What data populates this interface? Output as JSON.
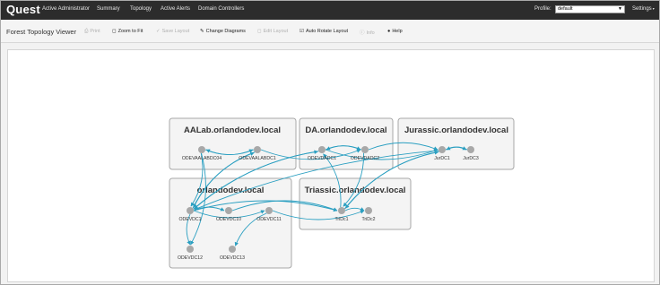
{
  "app": {
    "logo": "Quest",
    "nav": [
      "Active Administrator",
      "Summary",
      "Topology",
      "Active Alerts",
      "Domain Controllers"
    ],
    "profile_label": "Profile:",
    "profile_value": "default",
    "settings_label": "Settings"
  },
  "toolbar": {
    "title": "Forest Topology Viewer",
    "items": [
      {
        "label": "Print",
        "icon": "print-icon",
        "enabled": false
      },
      {
        "label": "Zoom to Fit",
        "icon": "zoom-fit-icon",
        "enabled": true
      },
      {
        "label": "Save Layout",
        "icon": "save-icon",
        "enabled": false
      },
      {
        "label": "Change Diagrams",
        "icon": "pencil-icon",
        "enabled": true
      },
      {
        "label": "Edit Layout",
        "icon": "edit-icon",
        "enabled": false
      },
      {
        "label": "Auto Rotate Layout",
        "icon": "checkbox-checked-icon",
        "enabled": true
      },
      {
        "label": "Info",
        "icon": "info-icon",
        "enabled": false
      },
      {
        "label": "Help",
        "icon": "help-icon",
        "enabled": true
      }
    ]
  },
  "colors": {
    "topbar": "#2c2c2c",
    "edge": "#2a9fc1",
    "node": "#a8a8a8",
    "domain_fill": "#f4f4f4"
  },
  "topology": {
    "domains": [
      {
        "name": "AALab.orlandodev.local"
      },
      {
        "name": "DA.orlandodev.local"
      },
      {
        "name": "Jurassic.orlandodev.local"
      },
      {
        "name": "orlandodev.local"
      },
      {
        "name": "Triassic.orlandodev.local"
      }
    ],
    "nodes": [
      {
        "id": "ODEVAALABDC04"
      },
      {
        "id": "ODEVAALABDC1"
      },
      {
        "id": "ODEVDADC1"
      },
      {
        "id": "ODEVDADC2"
      },
      {
        "id": "JurDC1"
      },
      {
        "id": "JurDC3"
      },
      {
        "id": "ODEVDC1"
      },
      {
        "id": "ODEVDC10"
      },
      {
        "id": "ODEVDC11"
      },
      {
        "id": "ODEVDC12"
      },
      {
        "id": "ODEVDC13"
      },
      {
        "id": "TriDc1"
      },
      {
        "id": "TriDc2"
      }
    ],
    "links": [
      [
        "ODEVAALABDC04",
        "ODEVAALABDC1"
      ],
      [
        "ODEVAALABDC1",
        "ODEVAALABDC04"
      ],
      [
        "ODEVAALABDC1",
        "ODEVDADC2"
      ],
      [
        "ODEVDADC1",
        "ODEVDADC2"
      ],
      [
        "ODEVDADC2",
        "ODEVDADC1"
      ],
      [
        "ODEVDADC2",
        "JurDC1"
      ],
      [
        "ODEVDADC1",
        "JurDC1"
      ],
      [
        "JurDC1",
        "JurDC3"
      ],
      [
        "JurDC3",
        "JurDC1"
      ],
      [
        "ODEVAALABDC04",
        "ODEVDC1"
      ],
      [
        "ODEVAALABDC1",
        "ODEVDC1"
      ],
      [
        "ODEVDC1",
        "ODEVAALABDC1"
      ],
      [
        "ODEVDC1",
        "ODEVDC12"
      ],
      [
        "ODEVAALABDC04",
        "ODEVDC12"
      ],
      [
        "ODEVDC11",
        "ODEVDC13"
      ],
      [
        "ODEVDC1",
        "ODEVDC10"
      ],
      [
        "ODEVDC1",
        "ODEVDC11"
      ],
      [
        "ODEVDC1",
        "ODEVDADC1"
      ],
      [
        "ODEVDADC1",
        "ODEVDC1"
      ],
      [
        "ODEVDC1",
        "TriDc1"
      ],
      [
        "ODEVDC11",
        "TriDc2"
      ],
      [
        "TriDc1",
        "TriDc2"
      ],
      [
        "TriDc1",
        "ODEVDADC1"
      ],
      [
        "ODEVDADC2",
        "TriDc1"
      ],
      [
        "JurDC1",
        "TriDc1"
      ],
      [
        "TriDc1",
        "JurDC1"
      ],
      [
        "JurDC1",
        "ODEVDC1"
      ],
      [
        "ODEVDC10",
        "TriDc1"
      ]
    ]
  }
}
